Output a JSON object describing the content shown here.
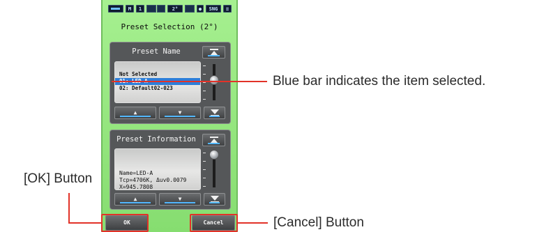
{
  "status_bar": {
    "mode_label": "M",
    "mode_value": "1",
    "angle": "2°",
    "mode_sng": "SNG"
  },
  "title": "Preset Selection (2°)",
  "preset_name_panel": {
    "header": "Preset Name",
    "items": [
      "Not Selected",
      "01: LED-A",
      "02: Default02-023"
    ],
    "selected_index": 1,
    "scroll_level": 0.0
  },
  "preset_info_panel": {
    "header": "Preset Information",
    "lines": [
      "Name=LED-A",
      "Tcp=4706K, Δuv0.0079",
      "X=945.7808"
    ],
    "scroll_level": 0.0
  },
  "buttons": {
    "ok": "OK",
    "cancel": "Cancel",
    "arrows": {
      "up": "▲",
      "down": "▼",
      "top": "▲",
      "bottom": "▼"
    }
  },
  "annotations": {
    "selected_bar": "Blue bar indicates the item selected.",
    "ok_button": "[OK] Button",
    "cancel_button": "[Cancel] Button"
  },
  "colors": {
    "screen_green": "#95e57d",
    "selection_blue": "#2e7ed8",
    "callout_red": "#e23228"
  }
}
